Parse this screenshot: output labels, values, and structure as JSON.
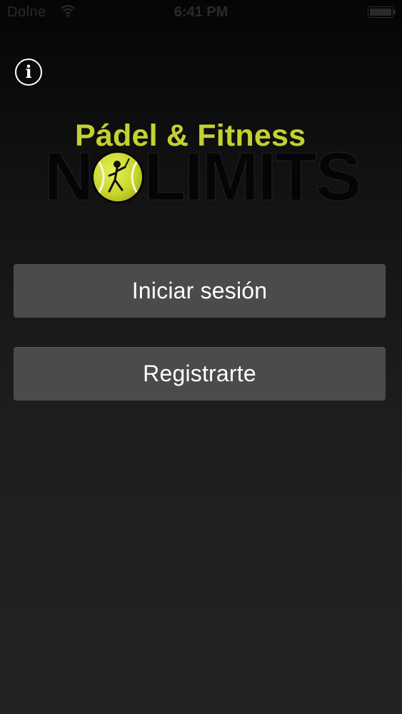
{
  "status_bar": {
    "carrier": "Dolne",
    "wifi_icon": "wifi-icon",
    "time": "6:41 PM",
    "battery_icon": "battery-icon"
  },
  "header": {
    "info_icon": "info-icon",
    "info_glyph": "i"
  },
  "logo": {
    "tagline": "Pádel & Fitness",
    "word_first": "N",
    "word_rest": "LIMITS",
    "ball_icon": "tennis-ball-icon",
    "colors": {
      "tagline": "#c4d130",
      "ball": "#c9d52a",
      "word": "#050505"
    }
  },
  "actions": {
    "login_label": "Iniciar sesión",
    "register_label": "Registrarte"
  },
  "colors": {
    "background_top": "#050505",
    "background_bottom": "#232324",
    "button": "#4b4b4c",
    "button_text": "#ffffff"
  }
}
